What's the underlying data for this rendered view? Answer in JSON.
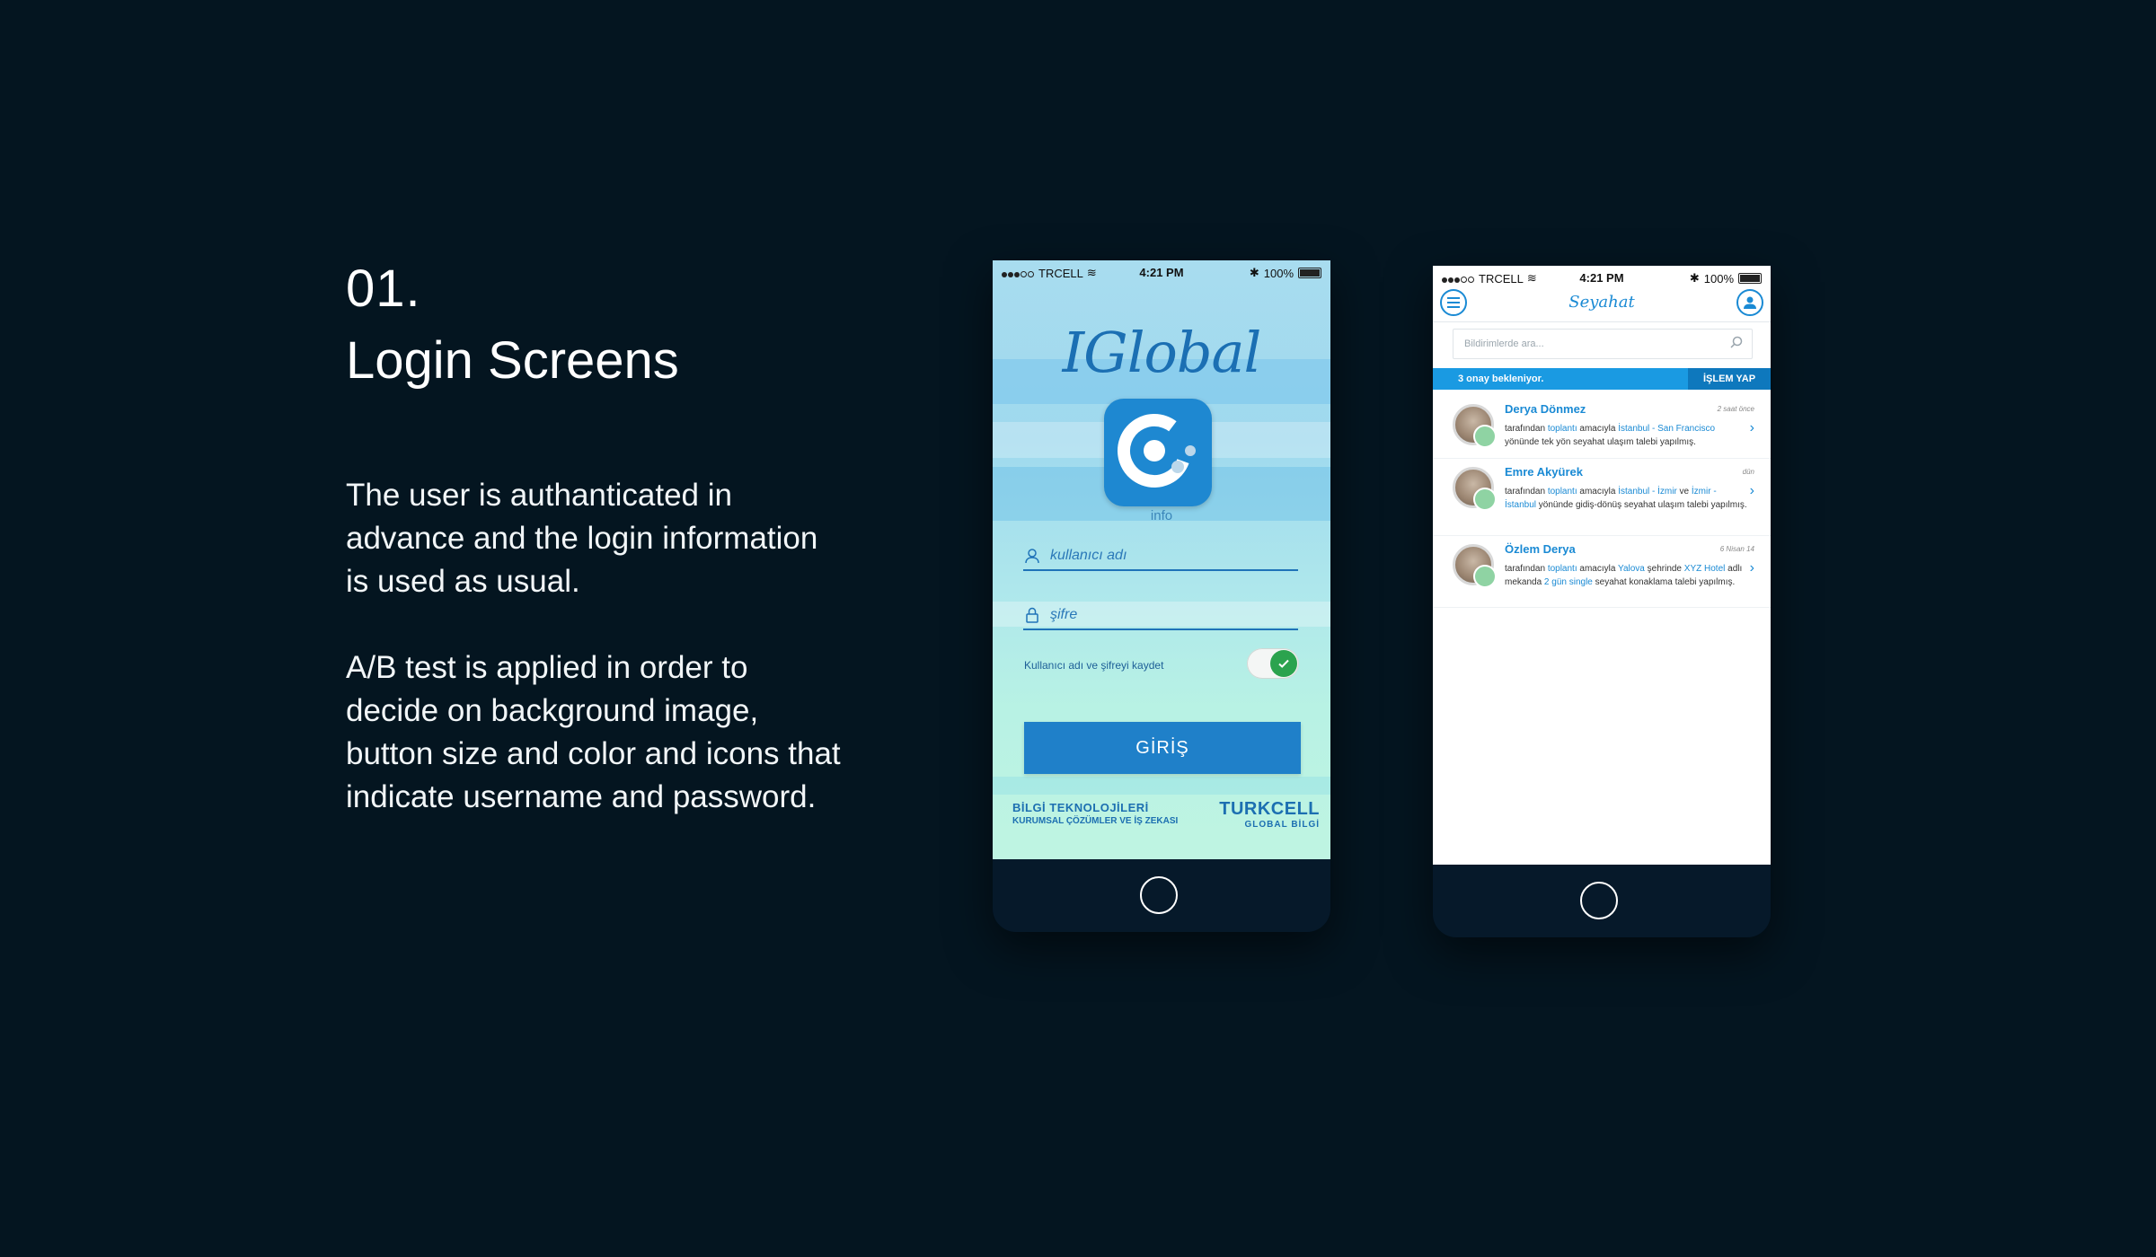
{
  "section": {
    "number": "01.",
    "title": "Login Screens",
    "paragraph1": "The user is authanticated in advance and the login information is used as usual.",
    "paragraph2": "A/B test is applied in order to decide on background image, button size and color and icons that indicate username and password."
  },
  "status_bar": {
    "carrier": "TRCELL",
    "time": "4:21 PM",
    "battery": "100%"
  },
  "login": {
    "logo": "IGlobal",
    "app_label": "info",
    "username_placeholder": "kullanıcı adı",
    "password_placeholder": "şifre",
    "remember_label": "Kullanıcı adı ve şifreyi kaydet",
    "login_button": "GİRİŞ",
    "footer_left_1": "BİLGİ TEKNOLOJİLERİ",
    "footer_left_2": "KURUMSAL ÇÖZÜMLER VE İŞ  ZEKASI",
    "footer_right_1": "TURKCELL",
    "footer_right_2": "GLOBAL BİLGİ"
  },
  "travel": {
    "title": "Seyahat",
    "search_placeholder": "Bildirimlerde ara...",
    "banner_text": "3 onay bekleniyor.",
    "banner_action": "İŞLEM YAP",
    "notifications": [
      {
        "name": "Derya Dönmez",
        "time": "2 saat önce",
        "parts": [
          "tarafından ",
          "toplantı",
          " amacıyla ",
          "İstanbul - San Francisco",
          " yönünde tek yön seyahat ulaşım talebi yapılmış."
        ]
      },
      {
        "name": "Emre Akyürek",
        "time": "dün",
        "parts": [
          "tarafından ",
          "toplantı",
          " amacıyla ",
          "İstanbul - İzmir",
          " ve ",
          "İzmir - İstanbul",
          " yönünde gidiş-dönüş seyahat ulaşım talebi yapılmış."
        ]
      },
      {
        "name": "Özlem Derya",
        "time": "6 Nisan 14",
        "parts": [
          "tarafından ",
          "toplantı",
          " amacıyla ",
          "Yalova",
          " şehrinde ",
          "XYZ Hotel",
          " adlı mekanda ",
          "2 gün single",
          " seyahat konaklama talebi yapılmış."
        ]
      }
    ]
  },
  "colors": {
    "background": "#041520",
    "accent": "#1f80c9",
    "brand_blue": "#1a8ad4",
    "toggle_green": "#2ba34e"
  }
}
